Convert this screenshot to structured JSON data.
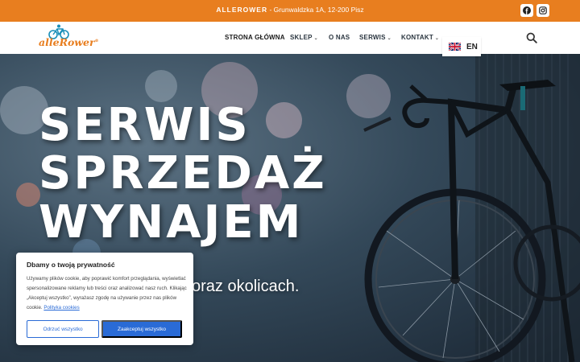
{
  "topbar": {
    "brand": "ALLEROWER",
    "address": " - Grunwaldzka 1A, 12-200 Pisz",
    "social": [
      "facebook-icon",
      "instagram-icon"
    ]
  },
  "header": {
    "logo": {
      "part1": "alle",
      "part2": "Rower"
    },
    "nav": [
      {
        "label": "STRONA GŁÓWNA"
      },
      {
        "label": "SKLEP"
      },
      {
        "label": "O NAS"
      },
      {
        "label": "SERWIS"
      },
      {
        "label": "KONTAKT"
      }
    ]
  },
  "language": {
    "code": "EN",
    "flag": "uk-flag-icon"
  },
  "hero": {
    "line1": "SERWIS",
    "line2": "SPRZEDAŻ",
    "line3": "WYNAJEM",
    "subtitle": "oraz okolicach."
  },
  "cookie": {
    "title": "Dbamy o twoją prywatność",
    "body": "Używamy plików cookie, aby poprawić komfort przeglądania, wyświetlać spersonalizowane reklamy lub treści oraz analizować nasz ruch. Klikając „Akceptuj wszystko”, wyrażasz zgodę na używanie przez nas plików cookie.",
    "policy_link": "Polityka cookies",
    "reject": "Odrzuć wszystko",
    "accept": "Zaakceptuj wszystko"
  },
  "colors": {
    "accent": "#e87e1f",
    "button_blue": "#2a6bd6"
  }
}
